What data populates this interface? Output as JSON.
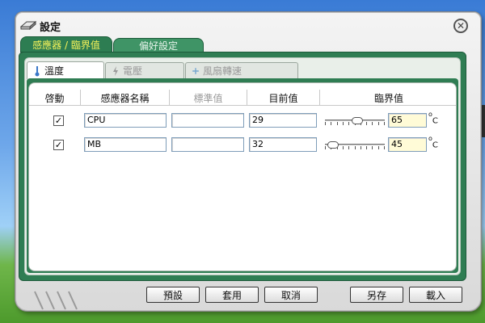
{
  "window": {
    "title": "設定",
    "close_label": "✕"
  },
  "top_tabs": [
    {
      "label": "感應器 / 臨界值",
      "active": true
    },
    {
      "label": "偏好設定",
      "active": false
    }
  ],
  "sub_tabs": [
    {
      "label": "溫度",
      "icon": "thermometer-icon",
      "active": true
    },
    {
      "label": "電壓",
      "icon": "lightning-icon",
      "active": false
    },
    {
      "label": "風扇轉速",
      "icon": "fan-icon",
      "active": false
    }
  ],
  "table": {
    "headers": [
      "啓動",
      "感應器名稱",
      "標準值",
      "目前值",
      "臨界值"
    ],
    "rows": [
      {
        "enabled": true,
        "check": "✓",
        "name": "CPU",
        "standard": "",
        "current": "29",
        "threshold": "65",
        "slider_level": 0.55,
        "unit": "C",
        "degree": "o"
      },
      {
        "enabled": true,
        "check": "✓",
        "name": "MB",
        "standard": "",
        "current": "32",
        "threshold": "45",
        "slider_level": 0.05,
        "unit": "C",
        "degree": "o"
      }
    ]
  },
  "buttons": {
    "preset": "預設",
    "apply": "套用",
    "cancel": "取消",
    "save_as": "另存",
    "load": "載入"
  },
  "colors": {
    "frame_green": "#2f7d53",
    "active_tab_text": "#f6f35a",
    "threshold_field": "#fffbd7"
  }
}
